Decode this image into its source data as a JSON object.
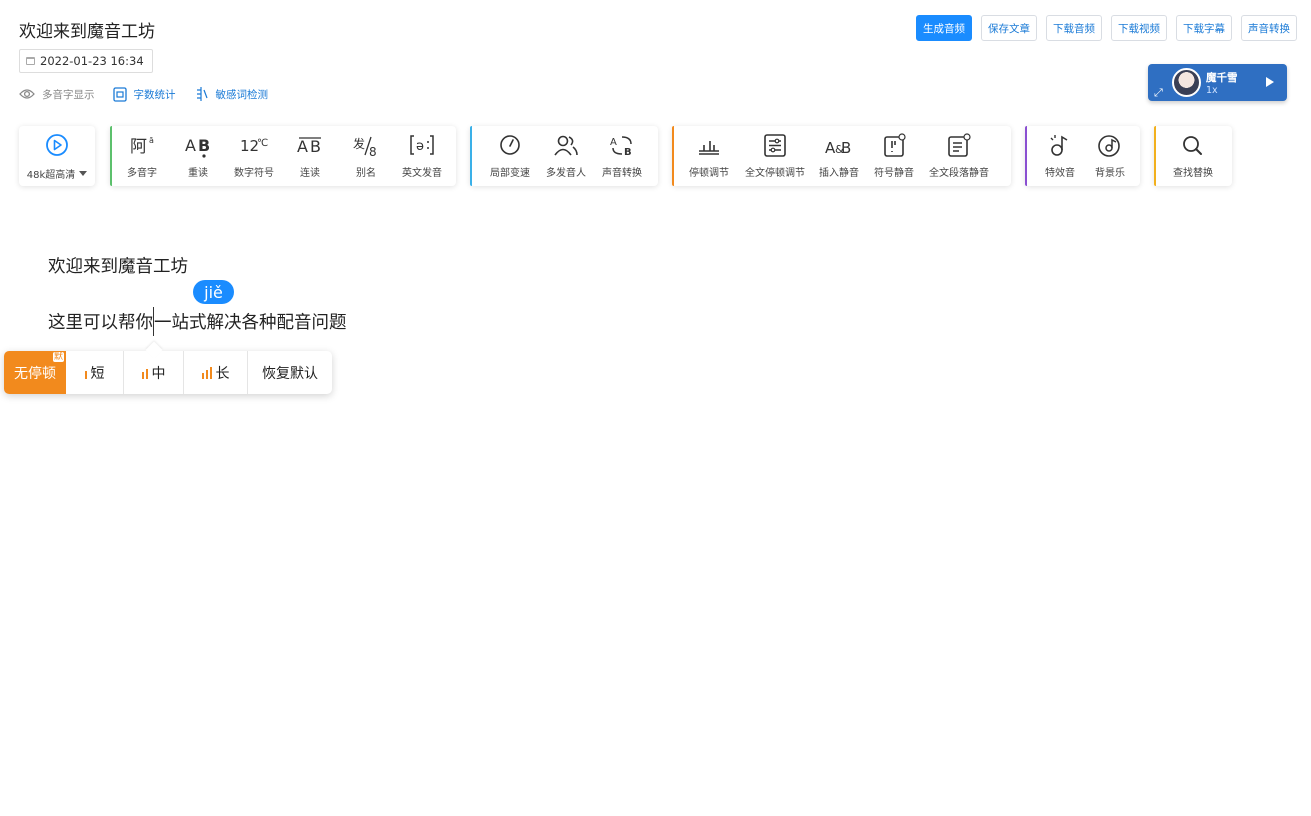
{
  "document": {
    "title": "欢迎来到魔音工坊",
    "date": "2022-01-23 16:34"
  },
  "top_actions": [
    {
      "label": "生成音频",
      "primary": true
    },
    {
      "label": "保存文章"
    },
    {
      "label": "下载音频"
    },
    {
      "label": "下载视频"
    },
    {
      "label": "下载字幕"
    },
    {
      "label": "声音转换"
    }
  ],
  "tools_row": {
    "polyphone_display": "多音字显示",
    "word_count": "字数统计",
    "sensitive_check": "敏感词检测"
  },
  "speaker": {
    "name": "魔千雪",
    "speed": "1x"
  },
  "toolbar": {
    "quality": "48k超高清",
    "group1": [
      "多音字",
      "重读",
      "数字符号",
      "连读",
      "别名",
      "英文发音"
    ],
    "group2": [
      "局部变速",
      "多发音人",
      "声音转换"
    ],
    "group3": [
      "停顿调节",
      "全文停顿调节",
      "插入静音",
      "符号静音",
      "全文段落静音"
    ],
    "group4": [
      "特效音",
      "背景乐"
    ],
    "group5": [
      "查找替换"
    ]
  },
  "colors": {
    "accent": "#1a8cff",
    "group2_bar": "#3ab0e8",
    "group3_bar": "#f28a1d",
    "group4_bar": "#8a4fd1",
    "group5_bar": "#f2b01d",
    "pause_active": "#f28a1d"
  },
  "editor": {
    "line1": "欢迎来到魔音工坊",
    "line2_before": "这里可以帮你",
    "line2_after": "一站式解决各种配音问题",
    "pinyin": "jiě"
  },
  "pause_menu": {
    "none": "无停顿",
    "default_badge": "默",
    "short": "短",
    "medium": "中",
    "long": "长",
    "reset": "恢复默认"
  }
}
